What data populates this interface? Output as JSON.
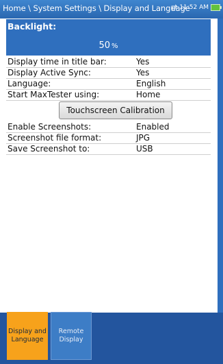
{
  "titlebar": {
    "breadcrumb": "Home \\ System Settings \\ Display and Language",
    "time": "11:52 AM"
  },
  "backlight": {
    "label": "Backlight:",
    "value": "50",
    "unit": "%"
  },
  "settings": [
    {
      "label": "Display time in title bar:",
      "value": "Yes"
    },
    {
      "label": "Display Active Sync:",
      "value": "Yes"
    },
    {
      "label": "Language:",
      "value": "English"
    },
    {
      "label": "Start MaxTester using:",
      "value": "Home"
    }
  ],
  "calibration_button": "Touchscreen Calibration",
  "screenshot_settings": [
    {
      "label": "Enable Screenshots:",
      "value": "Enabled"
    },
    {
      "label": "Screenshot file format:",
      "value": "JPG"
    },
    {
      "label": "Save Screenshot to:",
      "value": "USB"
    }
  ],
  "tabs": [
    {
      "label": "Display and Language",
      "active": true
    },
    {
      "label": "Remote Display",
      "active": false
    }
  ],
  "colors": {
    "accent": "#f7a21b",
    "titlebar": "#2a67b0",
    "panel": "#2f6fbe"
  }
}
